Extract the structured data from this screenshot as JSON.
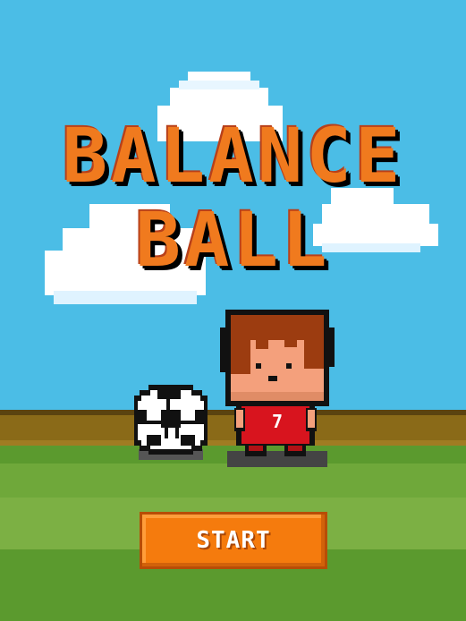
{
  "game": {
    "title_line1": "BALANCE",
    "title_line2": "BALL",
    "start_label": "START"
  },
  "player": {
    "jersey_number": "7"
  },
  "colors": {
    "sky": "#4bbde6",
    "title_orange": "#f07a1e",
    "button_orange": "#f57b0d",
    "grass_light": "#6fa83a",
    "grass_dark": "#5b9a2e",
    "dirt": "#8a6a18",
    "jersey_red": "#d8141e",
    "hair_brown": "#9c3c10"
  }
}
